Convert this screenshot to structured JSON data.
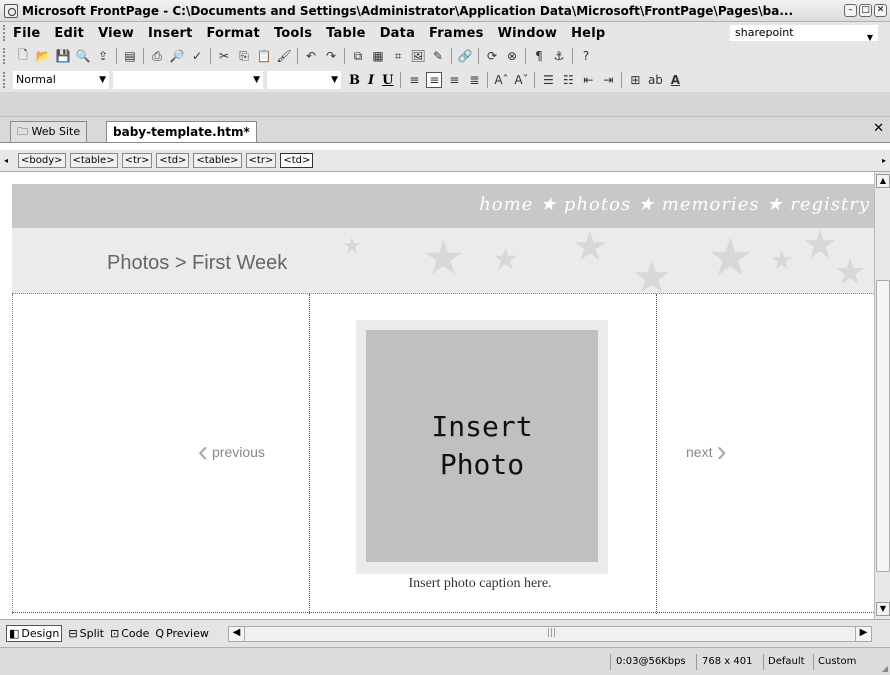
{
  "window": {
    "title": "Microsoft FrontPage - C:\\Documents and Settings\\Administrator\\Application Data\\Microsoft\\FrontPage\\Pages\\ba..."
  },
  "menu": {
    "items": [
      "File",
      "Edit",
      "View",
      "Insert",
      "Format",
      "Tools",
      "Table",
      "Data",
      "Frames",
      "Window",
      "Help"
    ],
    "help_search": "sharepoint"
  },
  "format_toolbar": {
    "style": "Normal",
    "bold": "B",
    "italic": "I",
    "underline": "U"
  },
  "tabs": {
    "website": "Web Site",
    "file": "baby-template.htm*"
  },
  "quicktags": [
    "<body>",
    "<table>",
    "<tr>",
    "<td>",
    "<table>",
    "<tr>",
    "<td>"
  ],
  "page": {
    "nav": "home ★ photos ★ memories ★ registry",
    "breadcrumb": "Photos > First Week",
    "previous": "previous",
    "next": "next",
    "photo_placeholder": "Insert\nPhoto",
    "caption": "Insert photo caption here."
  },
  "viewbar": {
    "design": "Design",
    "split": "Split",
    "code": "Code",
    "preview": "Preview"
  },
  "status": {
    "download": "0:03@56Kbps",
    "size": "768 x 401",
    "mode": "Default",
    "custom": "Custom"
  }
}
